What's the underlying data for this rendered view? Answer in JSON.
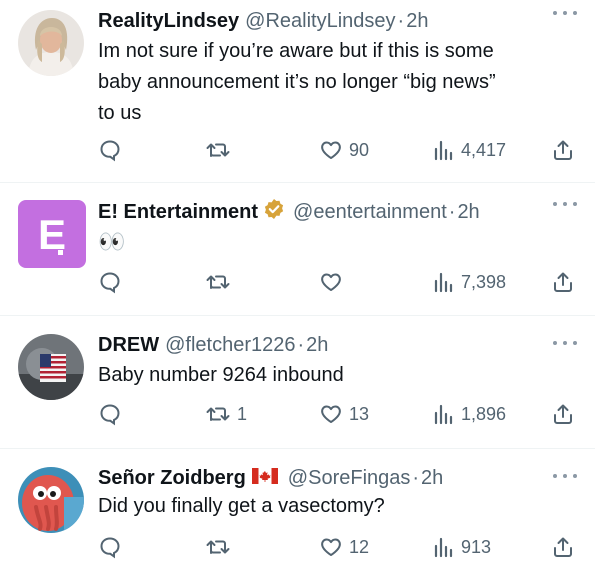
{
  "colors": {
    "text": "#0f1419",
    "muted": "#536471",
    "divider": "#eff3f4",
    "verified_gold": "#d7a33a",
    "e_purple": "#c36fe0"
  },
  "tweets": [
    {
      "name": "RealityLindsey",
      "handle": "@RealityLindsey",
      "separator": "·",
      "time": "2h",
      "lines": [
        "Im not sure if you’re aware but if this is some",
        "baby announcement it’s no longer “big news”",
        "to us"
      ],
      "replies": "",
      "retweets": "",
      "likes": "90",
      "views": "4,417"
    },
    {
      "name": "E! Entertainment",
      "verified": "gold-check-badge",
      "handle": "@eentertainment",
      "separator": "·",
      "time": "2h",
      "lines": [
        "👀"
      ],
      "replies": "",
      "retweets": "",
      "likes": "",
      "views": "7,398"
    },
    {
      "name": "DREW",
      "handle": "@fletcher1226",
      "separator": "·",
      "time": "2h",
      "lines": [
        "Baby number 9264 inbound"
      ],
      "replies": "",
      "retweets": "1",
      "likes": "13",
      "views": "1,896"
    },
    {
      "name": "Señor Zoidberg",
      "flag": "canada-flag",
      "handle": "@SoreFingas",
      "separator": "·",
      "time": "2h",
      "lines": [
        "Did you finally get a vasectomy?"
      ],
      "replies": "",
      "retweets": "",
      "likes": "12",
      "views": "913"
    }
  ]
}
